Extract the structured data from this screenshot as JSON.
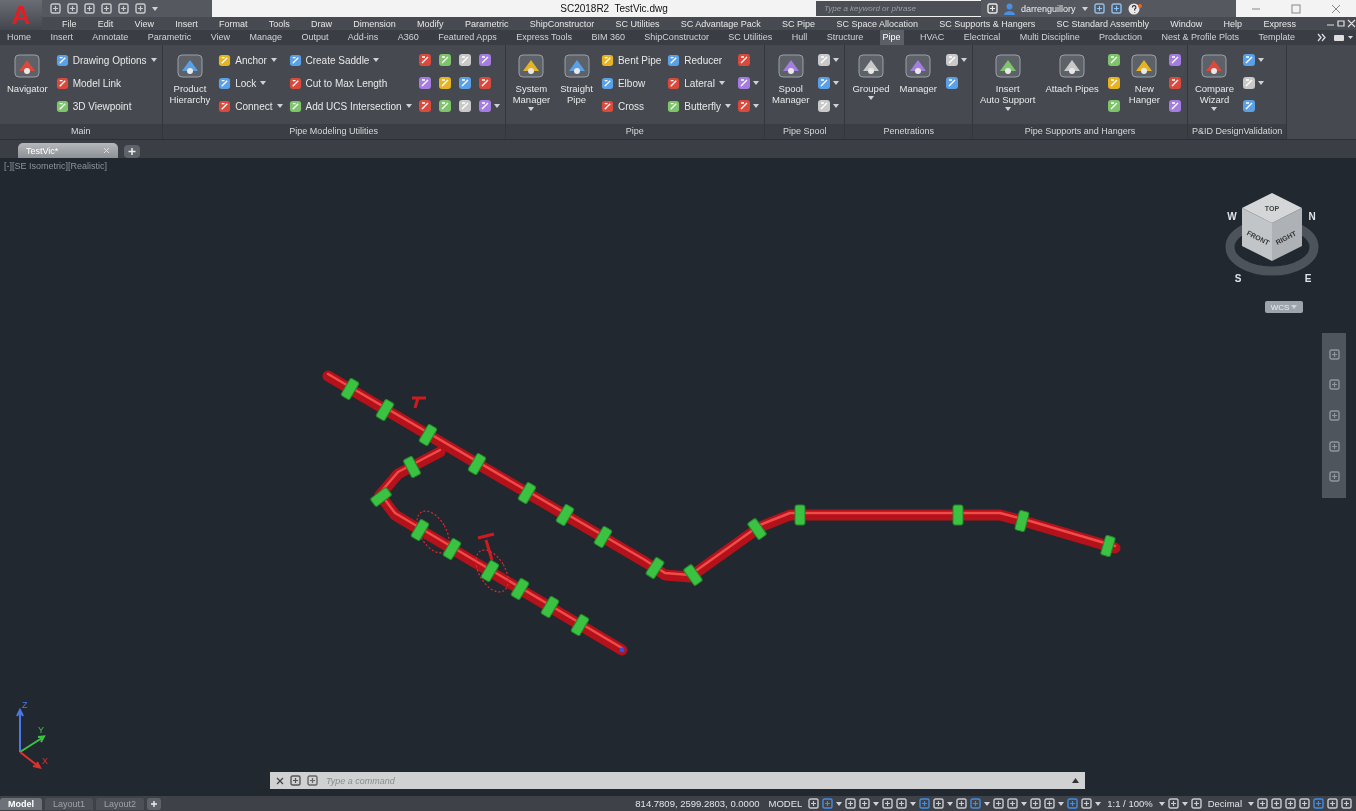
{
  "title_bar": {
    "logo": "A",
    "title": "SC2018R2  TestVic.dwg",
    "search": {
      "placeholder": "Type a keyword or phrase"
    },
    "user": "darrenguillory"
  },
  "menu": [
    "File",
    "Edit",
    "View",
    "Insert",
    "Format",
    "Tools",
    "Draw",
    "Dimension",
    "Modify",
    "Parametric",
    "ShipConstructor",
    "SC Utilities",
    "SC Advantage Pack",
    "SC Pipe",
    "SC Space Allocation",
    "SC Supports & Hangers",
    "SC Standard Assembly",
    "Window",
    "Help",
    "Express"
  ],
  "ribbon_tabs": [
    {
      "label": "Home",
      "selected": false
    },
    {
      "label": "Insert",
      "selected": false
    },
    {
      "label": "Annotate",
      "selected": false
    },
    {
      "label": "Parametric",
      "selected": false
    },
    {
      "label": "View",
      "selected": false
    },
    {
      "label": "Manage",
      "selected": false
    },
    {
      "label": "Output",
      "selected": false
    },
    {
      "label": "Add-ins",
      "selected": false
    },
    {
      "label": "A360",
      "selected": false
    },
    {
      "label": "Featured Apps",
      "selected": false
    },
    {
      "label": "Express Tools",
      "selected": false
    },
    {
      "label": "BIM 360",
      "selected": false
    },
    {
      "label": "ShipConstructor",
      "selected": false
    },
    {
      "label": "SC Utilities",
      "selected": false
    },
    {
      "label": "Hull",
      "selected": false
    },
    {
      "label": "Structure",
      "selected": false
    },
    {
      "label": "Pipe",
      "selected": true
    },
    {
      "label": "HVAC",
      "selected": false
    },
    {
      "label": "Electrical",
      "selected": false
    },
    {
      "label": "Multi Discipline",
      "selected": false
    },
    {
      "label": "Production",
      "selected": false
    },
    {
      "label": "Nest & Profile Plots",
      "selected": false
    },
    {
      "label": "Template",
      "selected": false
    }
  ],
  "ribbon_panels": [
    {
      "title": "Main",
      "items": [
        {
          "kind": "large",
          "label": "Navigator",
          "dropdown": false
        },
        {
          "kind": "stack",
          "buttons": [
            {
              "label": "Drawing Options",
              "dropdown": true
            },
            {
              "label": "Model Link",
              "dropdown": false
            },
            {
              "label": "3D Viewpoint",
              "dropdown": false
            }
          ]
        }
      ]
    },
    {
      "title": "Pipe Modeling Utilities",
      "items": [
        {
          "kind": "large",
          "label": "Product\nHierarchy",
          "dropdown": false
        },
        {
          "kind": "stack",
          "buttons": [
            {
              "label": "Anchor",
              "dropdown": true
            },
            {
              "label": "Lock",
              "dropdown": true
            },
            {
              "label": "Connect",
              "dropdown": true
            }
          ]
        },
        {
          "kind": "stack",
          "buttons": [
            {
              "label": "Create Saddle",
              "dropdown": true
            },
            {
              "label": "Cut to Max Length",
              "dropdown": false
            },
            {
              "label": "Add UCS Intersection",
              "dropdown": true
            }
          ]
        },
        {
          "kind": "grid",
          "rows": [
            [
              false,
              false,
              false,
              false
            ],
            [
              false,
              false,
              false,
              false
            ],
            [
              false,
              false,
              false,
              true
            ]
          ]
        }
      ]
    },
    {
      "title": "Pipe",
      "items": [
        {
          "kind": "large",
          "label": "System\nManager",
          "dropdown": true
        },
        {
          "kind": "large",
          "label": "Straight\nPipe",
          "dropdown": false
        },
        {
          "kind": "stack",
          "buttons": [
            {
              "label": "Bent Pipe",
              "dropdown": false
            },
            {
              "label": "Elbow",
              "dropdown": false
            },
            {
              "label": "Cross",
              "dropdown": false
            }
          ]
        },
        {
          "kind": "stack",
          "buttons": [
            {
              "label": "Reducer",
              "dropdown": false
            },
            {
              "label": "Lateral",
              "dropdown": true
            },
            {
              "label": "Butterfly",
              "dropdown": true
            }
          ]
        },
        {
          "kind": "grid",
          "rows": [
            [
              false
            ],
            [
              true
            ],
            [
              true
            ]
          ]
        }
      ]
    },
    {
      "title": "Pipe Spool",
      "items": [
        {
          "kind": "large",
          "label": "Spool\nManager",
          "dropdown": false
        },
        {
          "kind": "grid",
          "rows": [
            [
              true
            ],
            [
              true
            ],
            [
              true
            ]
          ]
        }
      ]
    },
    {
      "title": "Penetrations",
      "items": [
        {
          "kind": "large",
          "label": "Grouped",
          "dropdown": true
        },
        {
          "kind": "large",
          "label": "Manager",
          "dropdown": false
        },
        {
          "kind": "grid",
          "rows": [
            [
              true
            ],
            [
              false
            ]
          ]
        }
      ]
    },
    {
      "title": "Pipe Supports and Hangers",
      "items": [
        {
          "kind": "large",
          "label": "Insert\nAuto Support",
          "dropdown": true
        },
        {
          "kind": "large",
          "label": "Attach Pipes",
          "dropdown": false
        },
        {
          "kind": "grid",
          "rows": [
            [
              false
            ],
            [
              false
            ],
            [
              false
            ]
          ]
        },
        {
          "kind": "large",
          "label": "New\nHanger",
          "dropdown": false
        },
        {
          "kind": "grid",
          "rows": [
            [
              false
            ],
            [
              false
            ],
            [
              false
            ]
          ]
        }
      ]
    },
    {
      "title": "P&ID DesignValidation",
      "items": [
        {
          "kind": "large",
          "label": "Compare\nWizard",
          "dropdown": true
        },
        {
          "kind": "grid",
          "rows": [
            [
              true
            ],
            [
              true
            ],
            [
              false
            ]
          ]
        }
      ]
    }
  ],
  "doc_tabs": [
    {
      "label": "TestVic*",
      "selected": true
    }
  ],
  "viewport_label": "[-][SE Isometric][Realistic]",
  "viewcube": {
    "faces": [
      "TOP",
      "FRONT",
      "RIGHT"
    ],
    "compass": [
      "W",
      "N",
      "S",
      "E"
    ],
    "ucs": "WCS"
  },
  "ucs_axes": {
    "x": "X",
    "y": "Y",
    "z": "Z"
  },
  "command_line": {
    "placeholder": "Type a command"
  },
  "layout_tabs": [
    {
      "label": "Model",
      "selected": true
    },
    {
      "label": "Layout1",
      "selected": false
    },
    {
      "label": "Layout2",
      "selected": false
    }
  ],
  "status_bar": {
    "coordinates": "814.7809, 2599.2803, 0.0000",
    "space": "MODEL",
    "scale": "1:1 / 100%",
    "units": "Decimal"
  }
}
